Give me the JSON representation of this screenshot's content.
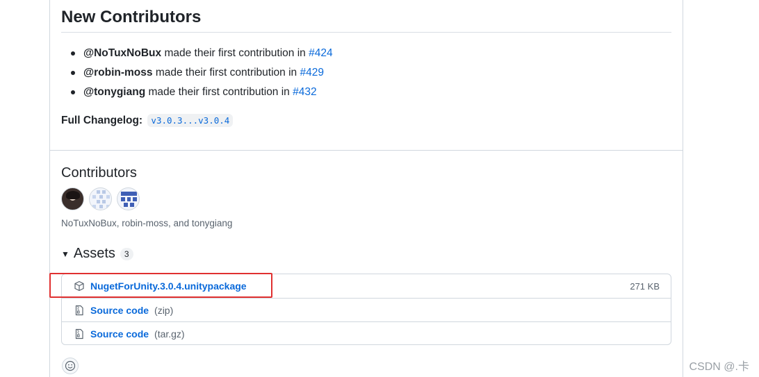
{
  "new_contributors": {
    "title": "New Contributors",
    "items": [
      {
        "user": "@NoTuxNoBux",
        "text": "made their first contribution in",
        "pr": "#424"
      },
      {
        "user": "@robin-moss",
        "text": "made their first contribution in",
        "pr": "#429"
      },
      {
        "user": "@tonygiang",
        "text": "made their first contribution in",
        "pr": "#432"
      }
    ]
  },
  "changelog": {
    "label": "Full Changelog:",
    "range": "v3.0.3...v3.0.4"
  },
  "contributors": {
    "title": "Contributors",
    "names": "NoTuxNoBux, robin-moss, and tonygiang"
  },
  "assets": {
    "title": "Assets",
    "count": "3",
    "items": [
      {
        "name": "NugetForUnity.3.0.4.unitypackage",
        "ext": "",
        "size": "271 KB",
        "icon": "package-icon"
      },
      {
        "name": "Source code",
        "ext": "(zip)",
        "size": "",
        "icon": "file-zip-icon"
      },
      {
        "name": "Source code",
        "ext": "(tar.gz)",
        "size": "",
        "icon": "file-zip-icon"
      }
    ]
  },
  "watermark": "CSDN @.卡",
  "colors": {
    "link": "#0969da",
    "highlight": "#e03030",
    "border": "#d0d7de"
  }
}
